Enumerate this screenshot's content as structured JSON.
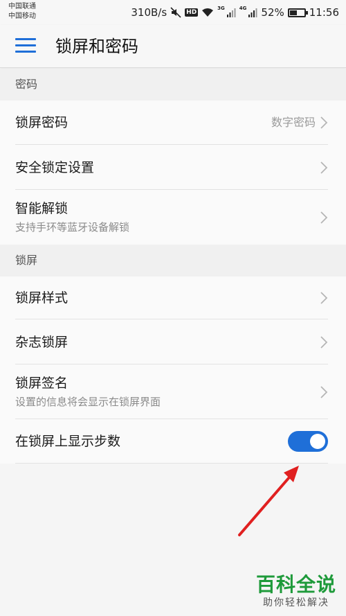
{
  "status_bar": {
    "carrier_1": "中国联通",
    "carrier_2": "中国移动",
    "speed": "310B/s",
    "hd_badge": "HD",
    "net_3g": "3G",
    "net_4g": "4G",
    "battery_percent": "52%",
    "battery_level": 0.52,
    "time": "11:56"
  },
  "app_bar": {
    "title": "锁屏和密码",
    "menu_icon": "hamburger-menu-icon"
  },
  "sections": [
    {
      "header": "密码",
      "items": [
        {
          "title": "锁屏密码",
          "value": "数字密码"
        },
        {
          "title": "安全锁定设置"
        },
        {
          "title": "智能解锁",
          "subtitle": "支持手环等蓝牙设备解锁"
        }
      ]
    },
    {
      "header": "锁屏",
      "items": [
        {
          "title": "锁屏样式"
        },
        {
          "title": "杂志锁屏"
        },
        {
          "title": "锁屏签名",
          "subtitle": "设置的信息将会显示在锁屏界面"
        },
        {
          "title": "在锁屏上显示步数",
          "toggle_on": true
        }
      ]
    }
  ],
  "watermark": {
    "title": "百科全说",
    "subtitle": "助你轻松解决"
  },
  "colors": {
    "accent": "#1f6fd8",
    "annotation_arrow": "#e02020",
    "watermark_green": "#1e9a3a"
  }
}
